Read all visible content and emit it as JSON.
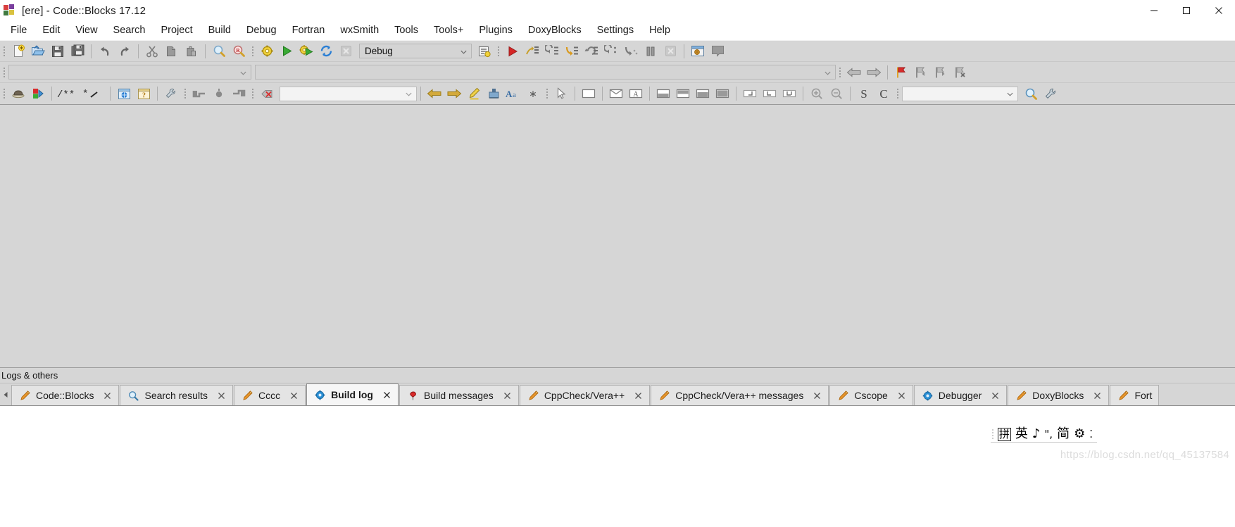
{
  "window": {
    "title": "[ere] - Code::Blocks 17.12",
    "app_icon": "codeblocks-logo-icon",
    "controls": {
      "minimize_label": "Minimize",
      "maximize_label": "Maximize",
      "close_label": "Close"
    }
  },
  "menubar": {
    "items": [
      {
        "label": "File"
      },
      {
        "label": "Edit"
      },
      {
        "label": "View"
      },
      {
        "label": "Search"
      },
      {
        "label": "Project"
      },
      {
        "label": "Build"
      },
      {
        "label": "Debug"
      },
      {
        "label": "Fortran"
      },
      {
        "label": "wxSmith"
      },
      {
        "label": "Tools"
      },
      {
        "label": "Tools+"
      },
      {
        "label": "Plugins"
      },
      {
        "label": "DoxyBlocks"
      },
      {
        "label": "Settings"
      },
      {
        "label": "Help"
      }
    ]
  },
  "toolbar_main": {
    "buttons": [
      {
        "name": "new-file-icon",
        "tooltip": "New file"
      },
      {
        "name": "open-folder-icon",
        "tooltip": "Open"
      },
      {
        "name": "save-icon",
        "tooltip": "Save"
      },
      {
        "name": "save-all-icon",
        "tooltip": "Save all files"
      },
      {
        "name": "undo-icon",
        "tooltip": "Undo"
      },
      {
        "name": "redo-icon",
        "tooltip": "Redo"
      },
      {
        "name": "cut-icon",
        "tooltip": "Cut"
      },
      {
        "name": "copy-icon",
        "tooltip": "Copy"
      },
      {
        "name": "paste-icon",
        "tooltip": "Paste"
      },
      {
        "name": "find-icon",
        "tooltip": "Find"
      },
      {
        "name": "replace-icon",
        "tooltip": "Replace"
      }
    ]
  },
  "toolbar_compiler": {
    "buttons": [
      {
        "name": "build-icon",
        "tooltip": "Build"
      },
      {
        "name": "run-icon",
        "tooltip": "Run"
      },
      {
        "name": "build-and-run-icon",
        "tooltip": "Build and run"
      },
      {
        "name": "rebuild-icon",
        "tooltip": "Rebuild"
      },
      {
        "name": "abort-build-icon",
        "tooltip": "Abort",
        "disabled": true
      }
    ],
    "target_select": {
      "value": "Debug",
      "placeholder": "Build target"
    },
    "select_target_icon": "select-target-icon"
  },
  "toolbar_debug": {
    "buttons": [
      {
        "name": "debug-continue-icon",
        "tooltip": "Debug / Continue"
      },
      {
        "name": "run-to-cursor-icon",
        "tooltip": "Run to cursor"
      },
      {
        "name": "next-line-icon",
        "tooltip": "Next line"
      },
      {
        "name": "step-into-icon",
        "tooltip": "Step into"
      },
      {
        "name": "step-out-icon",
        "tooltip": "Step out"
      },
      {
        "name": "next-instruction-icon",
        "tooltip": "Next instruction"
      },
      {
        "name": "step-into-instruction-icon",
        "tooltip": "Step into instruction"
      },
      {
        "name": "break-debugger-icon",
        "tooltip": "Break debugger"
      },
      {
        "name": "stop-debugger-icon",
        "tooltip": "Stop debugger",
        "disabled": true
      },
      {
        "name": "debugging-windows-icon",
        "tooltip": "Debugging windows"
      },
      {
        "name": "various-info-icon",
        "tooltip": "Various info",
        "disabled": true
      }
    ]
  },
  "toolbar_row2": {
    "symbol_select": {
      "value": "",
      "placeholder": ""
    },
    "scope_select": {
      "value": "",
      "placeholder": ""
    },
    "nav_buttons": [
      {
        "name": "back-arrow-icon",
        "tooltip": "Go back"
      },
      {
        "name": "forward-arrow-icon",
        "tooltip": "Go forward"
      }
    ],
    "bookmark_buttons": [
      {
        "name": "toggle-bookmark-icon",
        "tooltip": "Toggle bookmark"
      },
      {
        "name": "previous-bookmark-icon",
        "tooltip": "Previous bookmark"
      },
      {
        "name": "next-bookmark-icon",
        "tooltip": "Next bookmark"
      },
      {
        "name": "clear-bookmarks-icon",
        "tooltip": "Clear all bookmarks"
      }
    ]
  },
  "toolbar_row3": {
    "doxyblocks": [
      {
        "name": "doxyblocks-run-icon",
        "tooltip": "Run DoxyBlocks"
      },
      {
        "name": "doxyblocks-extract-icon",
        "tooltip": "Extract documentation"
      },
      {
        "name": "comment-block-icon",
        "tooltip": "Block comment"
      },
      {
        "name": "comment-line-icon",
        "tooltip": "Line comment"
      },
      {
        "name": "doxygen-html-icon",
        "tooltip": "Open HTML docs"
      },
      {
        "name": "doxygen-help-icon",
        "tooltip": "Help"
      },
      {
        "name": "doxyblocks-config-icon",
        "tooltip": "Configuration"
      }
    ],
    "fortran": [
      {
        "name": "jump-to-start-icon",
        "tooltip": "Jump to start"
      },
      {
        "name": "jump-node-icon",
        "tooltip": "Jump"
      },
      {
        "name": "jump-to-end-icon",
        "tooltip": "Jump to end"
      }
    ],
    "cscope": {
      "clear_icon": "cscope-clear-icon",
      "search_select": {
        "value": "",
        "placeholder": ""
      },
      "prev_icon": "cscope-previous-icon",
      "next_icon": "cscope-next-icon",
      "highlight_icon": "highlight-pencil-icon",
      "settings_icon": "cscope-settings-icon",
      "case_icon": "match-case-icon",
      "regex_icon": "regex-icon"
    },
    "wxsmith": [
      {
        "name": "pointer-tool-icon",
        "tooltip": "Select"
      },
      {
        "name": "panel-tool-icon",
        "tooltip": "Panel"
      },
      {
        "name": "dialog-tool-icon",
        "tooltip": "Dialog"
      },
      {
        "name": "frame-tool-icon",
        "tooltip": "Frame"
      },
      {
        "name": "layout-top-icon",
        "tooltip": "Layout top"
      },
      {
        "name": "layout-bottom-icon",
        "tooltip": "Layout bottom"
      },
      {
        "name": "layout-split-icon",
        "tooltip": "Layout split"
      },
      {
        "name": "layout-full-icon",
        "tooltip": "Layout full"
      },
      {
        "name": "align-tl-icon",
        "tooltip": "Align top-left"
      },
      {
        "name": "align-tr-icon",
        "tooltip": "Align top-right"
      },
      {
        "name": "align-br-icon",
        "tooltip": "Align bottom-right"
      },
      {
        "name": "zoom-in-icon",
        "tooltip": "Zoom in"
      },
      {
        "name": "zoom-out-icon",
        "tooltip": "Zoom out"
      },
      {
        "name": "spell-check-icon",
        "tooltip": "Spell check"
      },
      {
        "name": "thesaurus-icon",
        "tooltip": "Thesaurus"
      }
    ],
    "tools_plus": {
      "search_select": {
        "value": "",
        "placeholder": ""
      },
      "search_icon": "search-magnifier-icon",
      "config_icon": "wrench-icon"
    }
  },
  "logs_panel": {
    "caption": "Logs & others",
    "scroll_left_icon": "tab-scroll-left-icon",
    "tabs": [
      {
        "label": "Code::Blocks",
        "icon": "pencil-icon",
        "active": false,
        "closable": true
      },
      {
        "label": "Search results",
        "icon": "magnifier-icon",
        "active": false,
        "closable": true
      },
      {
        "label": "Cccc",
        "icon": "pencil-icon",
        "active": false,
        "closable": true
      },
      {
        "label": "Build log",
        "icon": "gear-blue-icon",
        "active": true,
        "closable": true
      },
      {
        "label": "Build messages",
        "icon": "pin-red-icon",
        "active": false,
        "closable": true
      },
      {
        "label": "CppCheck/Vera++",
        "icon": "pencil-icon",
        "active": false,
        "closable": true
      },
      {
        "label": "CppCheck/Vera++ messages",
        "icon": "pencil-icon",
        "active": false,
        "closable": true
      },
      {
        "label": "Cscope",
        "icon": "pencil-icon",
        "active": false,
        "closable": true
      },
      {
        "label": "Debugger",
        "icon": "gear-blue-icon",
        "active": false,
        "closable": true
      },
      {
        "label": "DoxyBlocks",
        "icon": "pencil-icon",
        "active": false,
        "closable": true
      },
      {
        "label": "Fort",
        "icon": "pencil-icon",
        "active": false,
        "closable": false
      }
    ]
  },
  "ime": {
    "mode_box": "拼",
    "lang": "英",
    "tone_icon": "♪",
    "punct_icon": "\",",
    "shape": "简",
    "settings_icon": "⚙",
    "expand_icon": "chevron-down-icon"
  },
  "watermark": {
    "text": "https://blog.csdn.net/qq_45137584"
  },
  "colors": {
    "toolbar_bg": "#d6d6d6",
    "editor_bg": "#d6d6d6",
    "tab_active_bg": "#f6f6f6",
    "accent_orange": "#e8a33d",
    "accent_red": "#cc2222",
    "accent_green": "#37a137",
    "accent_blue": "#2b7fd4"
  }
}
